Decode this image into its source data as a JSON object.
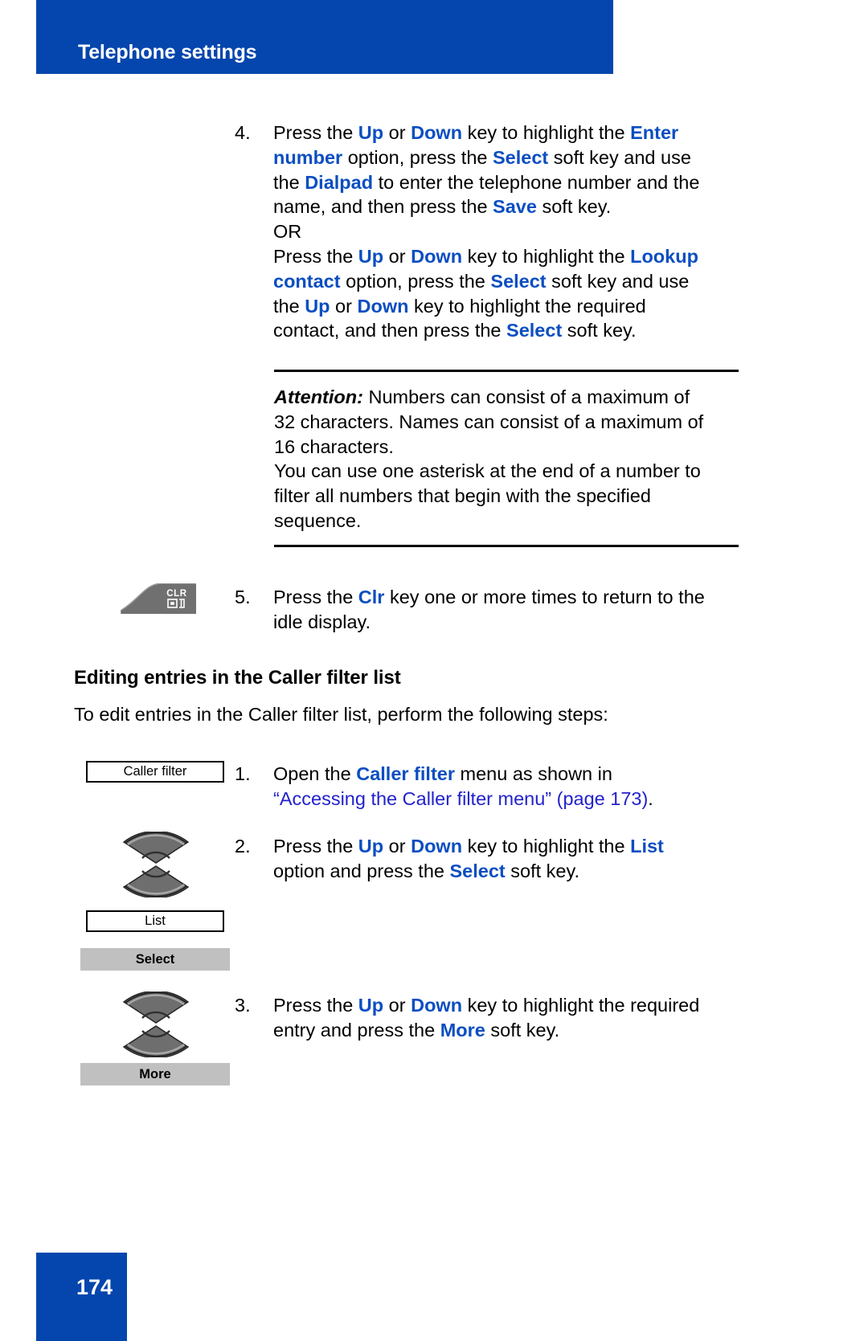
{
  "header": {
    "title": "Telephone settings",
    "bar_color": "#0446ad"
  },
  "footer": {
    "page_number": "174",
    "bar_color": "#0446ad"
  },
  "steps": [
    {
      "number": "4.",
      "lines": [
        [
          {
            "t": "Press the ",
            "s": "n"
          },
          {
            "t": "Up",
            "s": "b"
          },
          {
            "t": " or ",
            "s": "n"
          },
          {
            "t": "Down",
            "s": "b"
          },
          {
            "t": " key to highlight the ",
            "s": "n"
          },
          {
            "t": "Enter",
            "s": "b"
          }
        ],
        [
          {
            "t": "number",
            "s": "b"
          },
          {
            "t": " option, press the ",
            "s": "n"
          },
          {
            "t": "Select",
            "s": "b"
          },
          {
            "t": " soft key and use",
            "s": "n"
          }
        ],
        [
          {
            "t": "the ",
            "s": "n"
          },
          {
            "t": "Dialpad",
            "s": "b"
          },
          {
            "t": " to enter the telephone number and the",
            "s": "n"
          }
        ],
        [
          {
            "t": "name, and then press the ",
            "s": "n"
          },
          {
            "t": "Save",
            "s": "b"
          },
          {
            "t": " soft key.",
            "s": "n"
          }
        ],
        [
          {
            "t": "OR",
            "s": "n"
          }
        ],
        [
          {
            "t": "Press the ",
            "s": "n"
          },
          {
            "t": "Up",
            "s": "b"
          },
          {
            "t": " or ",
            "s": "n"
          },
          {
            "t": "Down",
            "s": "b"
          },
          {
            "t": " key to highlight the ",
            "s": "n"
          },
          {
            "t": "Lookup",
            "s": "b"
          }
        ],
        [
          {
            "t": "contact",
            "s": "b"
          },
          {
            "t": " option, press the ",
            "s": "n"
          },
          {
            "t": "Select",
            "s": "b"
          },
          {
            "t": " soft key and use",
            "s": "n"
          }
        ],
        [
          {
            "t": "the ",
            "s": "n"
          },
          {
            "t": "Up",
            "s": "b"
          },
          {
            "t": " or ",
            "s": "n"
          },
          {
            "t": "Down",
            "s": "b"
          },
          {
            "t": " key to highlight the required",
            "s": "n"
          }
        ],
        [
          {
            "t": "contact, and then press the ",
            "s": "n"
          },
          {
            "t": "Select",
            "s": "b"
          },
          {
            "t": " soft key.",
            "s": "n"
          }
        ]
      ]
    },
    {
      "number": "5.",
      "lines": [
        [
          {
            "t": "Press the ",
            "s": "n"
          },
          {
            "t": "Clr",
            "s": "b"
          },
          {
            "t": " key one or more times to return to the",
            "s": "n"
          }
        ],
        [
          {
            "t": "idle display.",
            "s": "n"
          }
        ]
      ]
    },
    {
      "number": "1.",
      "lines": [
        [
          {
            "t": "Open the ",
            "s": "n"
          },
          {
            "t": "Caller filter",
            "s": "b"
          },
          {
            "t": " menu as shown in",
            "s": "n"
          }
        ],
        [
          {
            "t": "“Accessing the Caller filter menu” (page 173)",
            "s": "l"
          },
          {
            "t": ".",
            "s": "n"
          }
        ]
      ]
    },
    {
      "number": "2.",
      "lines": [
        [
          {
            "t": "Press the ",
            "s": "n"
          },
          {
            "t": "Up",
            "s": "b"
          },
          {
            "t": " or ",
            "s": "n"
          },
          {
            "t": "Down",
            "s": "b"
          },
          {
            "t": " key to highlight the ",
            "s": "n"
          },
          {
            "t": "List",
            "s": "b"
          }
        ],
        [
          {
            "t": "option and press the ",
            "s": "n"
          },
          {
            "t": "Select",
            "s": "b"
          },
          {
            "t": " soft key.",
            "s": "n"
          }
        ]
      ]
    },
    {
      "number": "3.",
      "lines": [
        [
          {
            "t": "Press the ",
            "s": "n"
          },
          {
            "t": "Up",
            "s": "b"
          },
          {
            "t": " or ",
            "s": "n"
          },
          {
            "t": "Down",
            "s": "b"
          },
          {
            "t": " key to highlight the required",
            "s": "n"
          }
        ],
        [
          {
            "t": "entry and press the ",
            "s": "n"
          },
          {
            "t": "More",
            "s": "b"
          },
          {
            "t": " soft key.",
            "s": "n"
          }
        ]
      ]
    }
  ],
  "attention": {
    "label": "Attention:",
    "lines": [
      " Numbers can consist of a maximum of",
      "32 characters. Names can consist of a maximum of",
      "16 characters.",
      "You can use one asterisk at the end of a number to",
      "filter all numbers that begin with the specified",
      "sequence."
    ]
  },
  "section": {
    "heading": "Editing entries in the Caller filter list",
    "intro": "To edit entries in the Caller filter list, perform the following steps:"
  },
  "key_graphics": {
    "clr_label": "CLR"
  },
  "labels": {
    "caller_filter_box": "Caller filter",
    "list_box": "List",
    "select_softkey": "Select",
    "more_softkey": "More"
  },
  "colors": {
    "keyword_blue": "#0b4ec1",
    "link_blue": "#2222cc",
    "brand_blue": "#0446ad",
    "softkey_gray": "#c0c0c0",
    "key_icon_gray": "#707070"
  }
}
